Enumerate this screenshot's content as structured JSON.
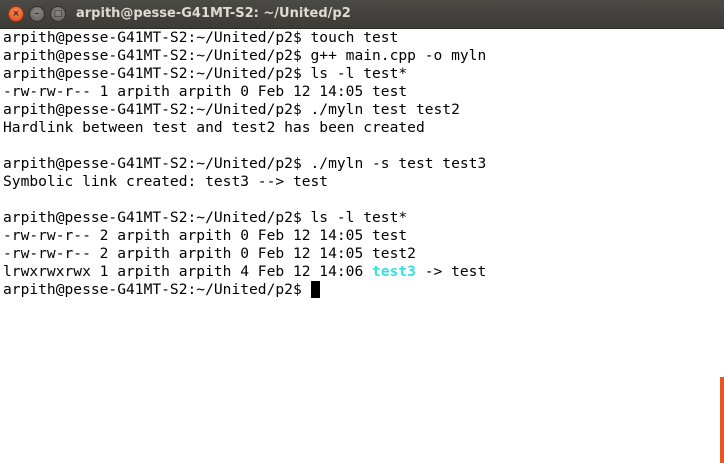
{
  "window": {
    "title": "arpith@pesse-G41MT-S2: ~/United/p2",
    "close_glyph": "×",
    "minimize_glyph": "–",
    "maximize_glyph": "□"
  },
  "terminal": {
    "lines": [
      "arpith@pesse-G41MT-S2:~/United/p2$ touch test",
      "arpith@pesse-G41MT-S2:~/United/p2$ g++ main.cpp -o myln",
      "arpith@pesse-G41MT-S2:~/United/p2$ ls -l test*",
      "-rw-rw-r-- 1 arpith arpith 0 Feb 12 14:05 test",
      "arpith@pesse-G41MT-S2:~/United/p2$ ./myln test test2",
      "Hardlink between test and test2 has been created",
      "",
      "arpith@pesse-G41MT-S2:~/United/p2$ ./myln -s test test3",
      "Symbolic link created: test3 --> test",
      "",
      "arpith@pesse-G41MT-S2:~/United/p2$ ls -l test*",
      "-rw-rw-r-- 2 arpith arpith 0 Feb 12 14:05 test",
      "-rw-rw-r-- 2 arpith arpith 0 Feb 12 14:05 test2"
    ],
    "symlink_line": {
      "prefix": "lrwxrwxrwx 1 arpith arpith 4 Feb 12 14:06 ",
      "link_name": "test3",
      "suffix": " -> test"
    },
    "prompt": "arpith@pesse-G41MT-S2:~/United/p2$ "
  },
  "colors": {
    "symlink": "#34e2e2",
    "scrollbar_thumb": "#e95420",
    "titlebar": "#3c3b37"
  }
}
